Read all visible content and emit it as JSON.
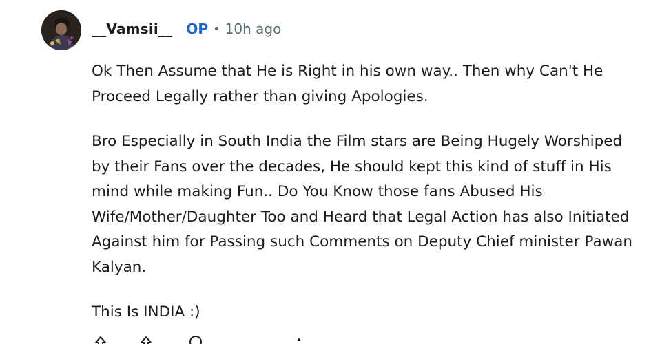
{
  "comment": {
    "author": "__Vamsii__",
    "op_label": "OP",
    "separator": "•",
    "timestamp": "10h ago",
    "paragraphs": [
      "Ok Then Assume that He is Right in his own way.. Then why Can't He Proceed Legally rather than giving Apologies.",
      "Bro Especially in South India the Film stars are Being Hugely Worshiped by their Fans over the decades, He should kept this kind of stuff in His mind while making Fun.. Do You Know those fans Abused His Wife/Mother/Daughter Too and Heard that Legal Action has also Initiated Against him for Passing such Comments on Deputy Chief minister Pawan Kalyan.",
      "This Is INDIA :)"
    ],
    "actions": {
      "upvote_icon": "upvote-icon",
      "downvote_icon": "downvote-icon",
      "reply_icon": "reply-icon",
      "more_icon": "more-icon"
    }
  },
  "colors": {
    "op": "#1a62d6",
    "meta_text": "#576f76",
    "body_text": "#1c1c1c"
  }
}
